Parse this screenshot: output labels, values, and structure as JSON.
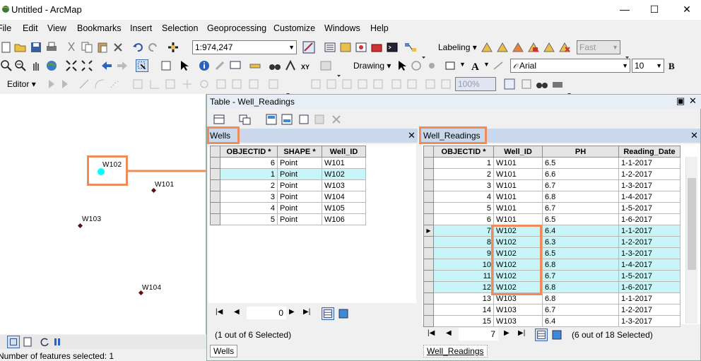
{
  "window": {
    "title": "Untitled - ArcMap",
    "minimize": "—",
    "maximize": "☐",
    "close": "✕"
  },
  "menu": [
    "File",
    "Edit",
    "View",
    "Bookmarks",
    "Insert",
    "Selection",
    "Geoprocessing",
    "Customize",
    "Windows",
    "Help"
  ],
  "toolbar": {
    "scale": "1:974,247",
    "labeling": "Labeling",
    "quality": "Fast",
    "drawing": "Drawing",
    "font_name": "Arial",
    "font_size": "10",
    "bold": "B",
    "editor": "Editor",
    "zoom_pct": "100%"
  },
  "map": {
    "points": [
      {
        "label": "W102",
        "selected": true
      },
      {
        "label": "W101",
        "selected": false
      },
      {
        "label": "W103",
        "selected": false
      },
      {
        "label": "W104",
        "selected": false
      }
    ],
    "status": "Number of features selected: 1",
    "colors": {
      "selected": "#00ffff",
      "point": "#5a1010",
      "highlight": "#f08c5a"
    }
  },
  "table_window": {
    "title": "Table - Well_Readings",
    "wells": {
      "name": "Wells",
      "columns": [
        "OBJECTID *",
        "SHAPE *",
        "Well_ID"
      ],
      "rows": [
        {
          "cells": [
            "6",
            "Point",
            "W101"
          ],
          "selected": false
        },
        {
          "cells": [
            "1",
            "Point",
            "W102"
          ],
          "selected": true
        },
        {
          "cells": [
            "2",
            "Point",
            "W103"
          ],
          "selected": false
        },
        {
          "cells": [
            "3",
            "Point",
            "W104"
          ],
          "selected": false
        },
        {
          "cells": [
            "4",
            "Point",
            "W105"
          ],
          "selected": false
        },
        {
          "cells": [
            "5",
            "Point",
            "W106"
          ],
          "selected": false
        }
      ],
      "record": "0",
      "summary": "(1 out of 6 Selected)",
      "tab": "Wells"
    },
    "readings": {
      "name": "Well_Readings",
      "columns": [
        "OBJECTID *",
        "Well_ID",
        "PH",
        "Reading_Date"
      ],
      "rows": [
        {
          "cells": [
            "1",
            "W101",
            "6.5",
            "1-1-2017"
          ],
          "selected": false
        },
        {
          "cells": [
            "2",
            "W101",
            "6.6",
            "1-2-2017"
          ],
          "selected": false
        },
        {
          "cells": [
            "3",
            "W101",
            "6.7",
            "1-3-2017"
          ],
          "selected": false
        },
        {
          "cells": [
            "4",
            "W101",
            "6.8",
            "1-4-2017"
          ],
          "selected": false
        },
        {
          "cells": [
            "5",
            "W101",
            "6.7",
            "1-5-2017"
          ],
          "selected": false
        },
        {
          "cells": [
            "6",
            "W101",
            "6.5",
            "1-6-2017"
          ],
          "selected": false
        },
        {
          "cells": [
            "7",
            "W102",
            "6.4",
            "1-1-2017"
          ],
          "selected": true,
          "current": true
        },
        {
          "cells": [
            "8",
            "W102",
            "6.3",
            "1-2-2017"
          ],
          "selected": true
        },
        {
          "cells": [
            "9",
            "W102",
            "6.5",
            "1-3-2017"
          ],
          "selected": true
        },
        {
          "cells": [
            "10",
            "W102",
            "6.8",
            "1-4-2017"
          ],
          "selected": true
        },
        {
          "cells": [
            "11",
            "W102",
            "6.7",
            "1-5-2017"
          ],
          "selected": true
        },
        {
          "cells": [
            "12",
            "W102",
            "6.8",
            "1-6-2017"
          ],
          "selected": true
        },
        {
          "cells": [
            "13",
            "W103",
            "6.8",
            "1-1-2017"
          ],
          "selected": false
        },
        {
          "cells": [
            "14",
            "W103",
            "6.7",
            "1-2-2017"
          ],
          "selected": false
        },
        {
          "cells": [
            "15",
            "W103",
            "6.4",
            "1-3-2017"
          ],
          "selected": false
        }
      ],
      "record": "7",
      "summary": "(6 out of 18 Selected)",
      "tab": "Well_Readings"
    }
  }
}
